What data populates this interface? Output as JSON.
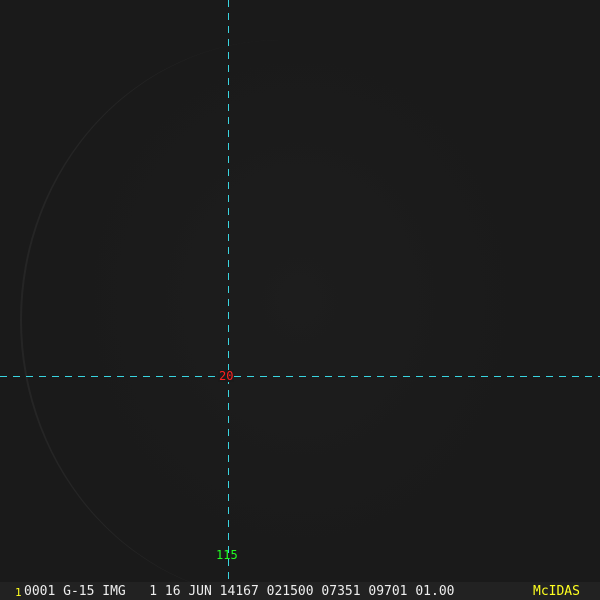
{
  "overlay": {
    "latitude_label": "20",
    "longitude_label": "115",
    "line_color": "#39d5e0"
  },
  "status_bar": {
    "frame_number": "1",
    "info": "0001 G-15 IMG   1 16 JUN 14167 021500 07351 09701 01.00",
    "brand": "McIDAS"
  }
}
